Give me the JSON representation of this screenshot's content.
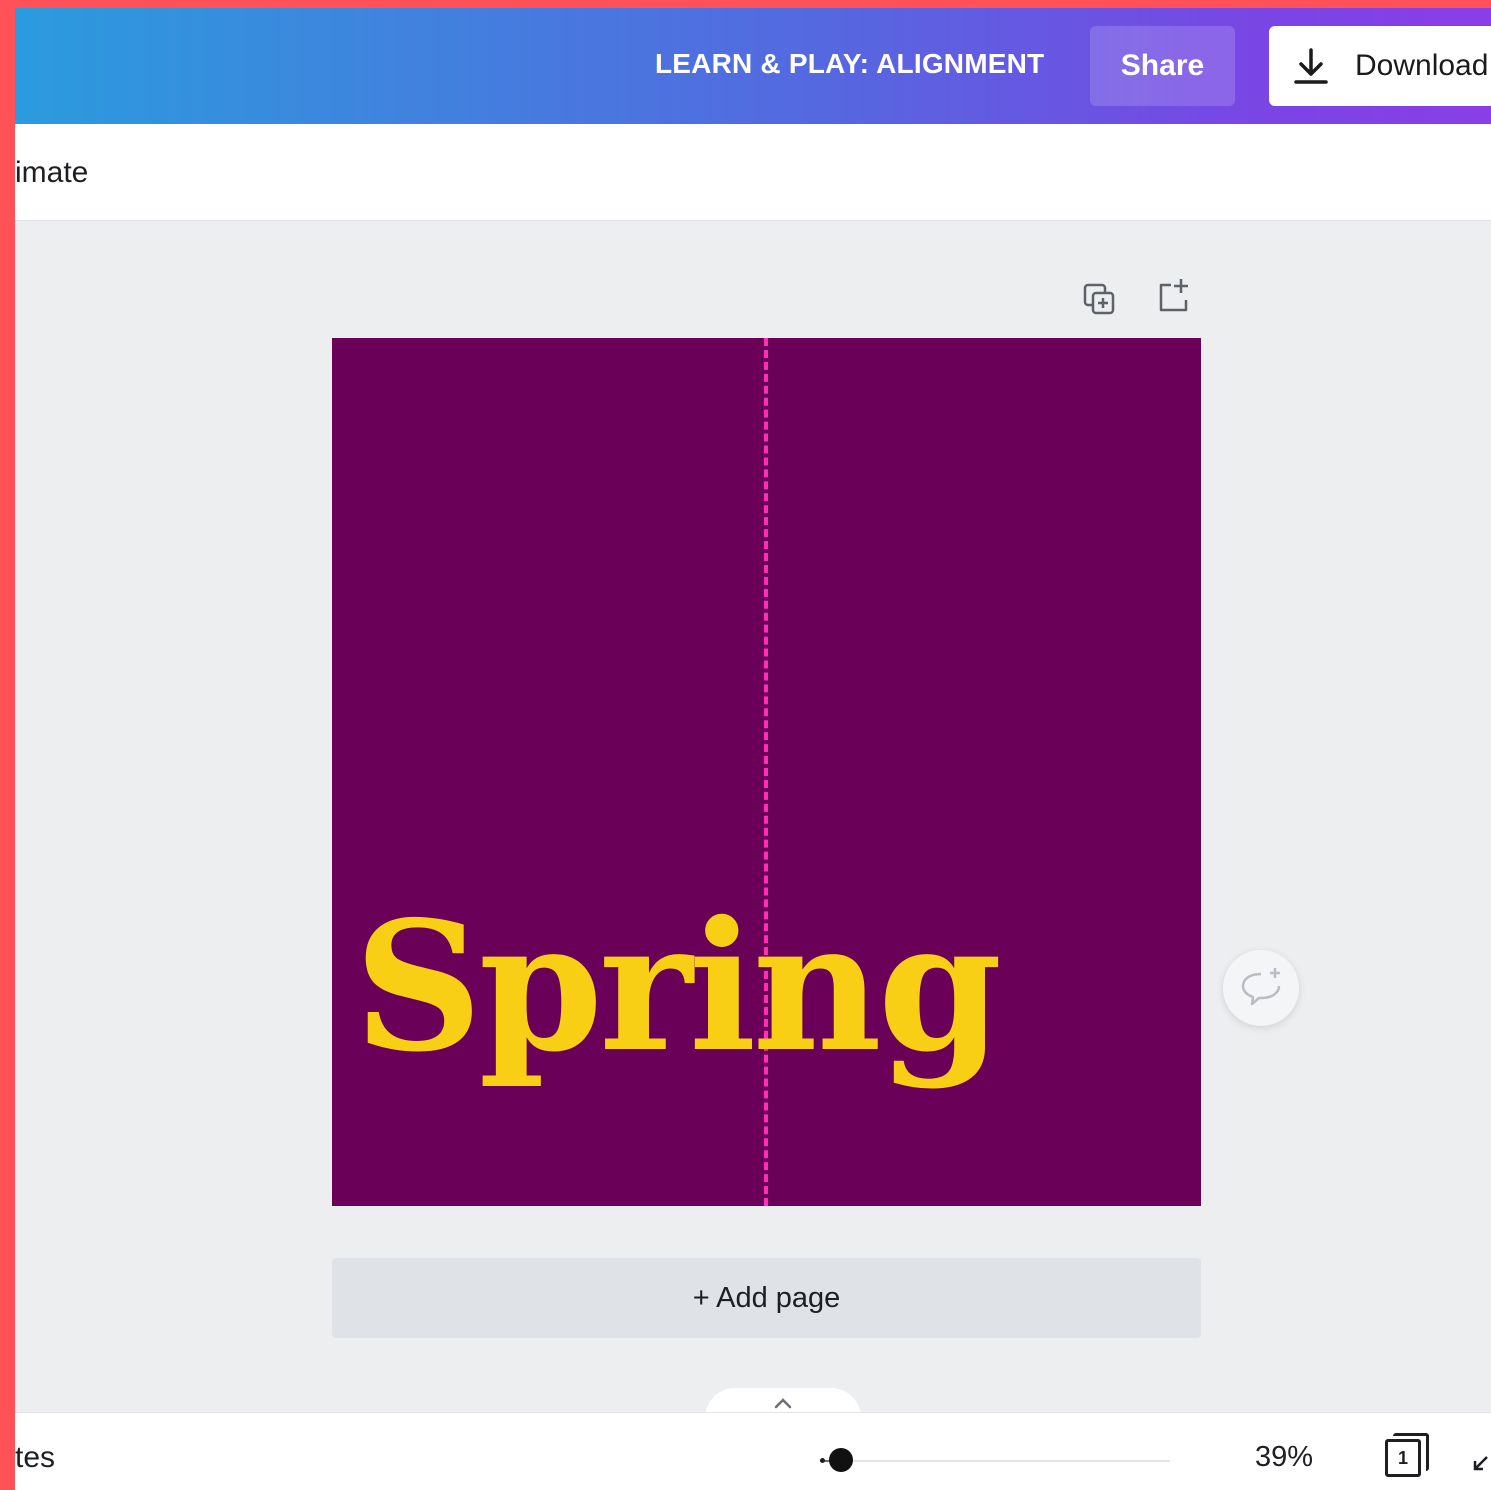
{
  "header": {
    "title": "LEARN & PLAY: ALIGNMENT",
    "share_label": "Share",
    "download_label": "Download"
  },
  "toolbar": {
    "animate_label": "imate"
  },
  "canvas": {
    "background": "#6a0057",
    "text": "Spring",
    "text_color": "#f9cf16",
    "guide_color": "#ff2fb4"
  },
  "add_page_label": "+ Add page",
  "footer": {
    "notes_label": "tes",
    "zoom_fraction": 0.06,
    "zoom_label": "39%",
    "page_number": "1"
  }
}
